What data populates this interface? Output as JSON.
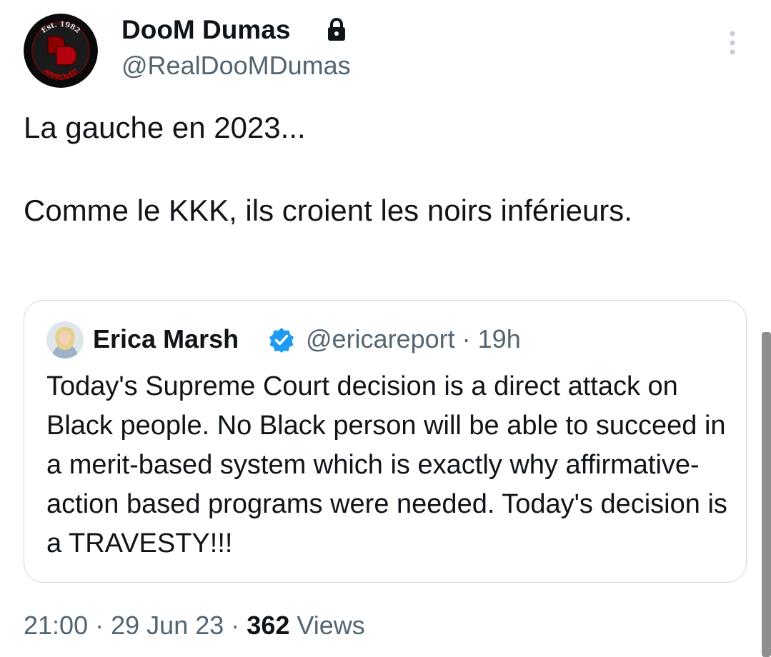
{
  "tweet": {
    "author": {
      "display_name": "DooM Dumas",
      "handle": "@RealDooMDumas",
      "avatar_icon": "doom-dumas-logo",
      "avatar_text_top": "Est. 1982",
      "avatar_text_bottom": "APPROVED",
      "protected_icon": "lock-icon"
    },
    "more_icon": "vertical-ellipsis-icon",
    "text_lines": [
      "La gauche en 2023...",
      "Comme le KKK, ils croient les noirs inférieurs."
    ],
    "quoted": {
      "display_name": "Erica Marsh",
      "verified_icon": "verified-badge-icon",
      "handle": "@ericareport",
      "separator": "·",
      "time": "19h",
      "text": "Today's Supreme Court decision is a direct attack on Black people. No Black person will be able to succeed in a merit-based system which is exactly why affirmative-action based programs were needed. Today's decision is a TRAVESTY!!!"
    },
    "footer": {
      "time": "21:00",
      "separator": "·",
      "date": "29 Jun 23",
      "views_count": "362",
      "views_label": "Views"
    }
  },
  "colors": {
    "text_primary": "#0f1419",
    "text_secondary": "#536471",
    "verified_blue": "#1d9bf0",
    "card_border": "#cfd9de"
  }
}
